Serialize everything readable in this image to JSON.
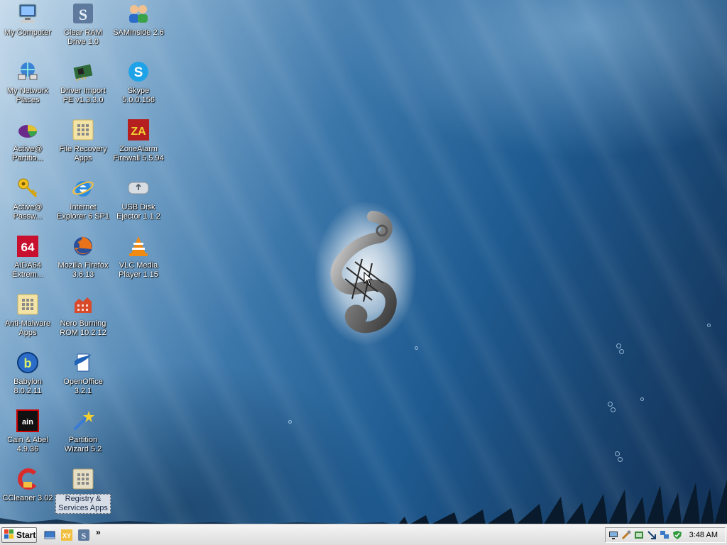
{
  "desktop": {
    "icons": [
      {
        "id": "my-computer",
        "label": "My Computer",
        "icon": "computer-icon"
      },
      {
        "id": "my-network-places",
        "label": "My Network\nPlaces",
        "icon": "network-icon"
      },
      {
        "id": "active-partition",
        "label": "Active@\nPartitio...",
        "icon": "partition-pie-icon"
      },
      {
        "id": "active-password",
        "label": "Active@\nPassw...",
        "icon": "key-icon"
      },
      {
        "id": "aida64",
        "label": "AIDA64\nExtrem...",
        "icon": "aida64-icon"
      },
      {
        "id": "anti-malware",
        "label": "Anti-Malware\nApps",
        "icon": "folder-apps-icon"
      },
      {
        "id": "babylon",
        "label": "Babylon\n8.0.2.11",
        "icon": "babylon-icon"
      },
      {
        "id": "cain-abel",
        "label": "Cain & Abel\n4.9.36",
        "icon": "cain-icon"
      },
      {
        "id": "ccleaner",
        "label": "CCleaner 3.02",
        "icon": "ccleaner-icon"
      },
      {
        "id": "clear-ram",
        "label": "Clear RAM\nDrive 1.0",
        "icon": "ram-drive-icon"
      },
      {
        "id": "driver-import",
        "label": "Driver Import\nPE v1.3.3.0",
        "icon": "chip-icon"
      },
      {
        "id": "file-recovery",
        "label": "File Recovery\nApps",
        "icon": "folder-apps-icon"
      },
      {
        "id": "internet-explorer",
        "label": "Internet\nExplorer 6 SP1",
        "icon": "ie-icon"
      },
      {
        "id": "mozilla-firefox",
        "label": "Mozilla Firefox\n3.6.13",
        "icon": "firefox-icon"
      },
      {
        "id": "nero",
        "label": "Nero Burning\nROM 10.2.12",
        "icon": "nero-icon"
      },
      {
        "id": "openoffice",
        "label": "OpenOffice\n3.2.1",
        "icon": "openoffice-icon"
      },
      {
        "id": "partition-wizard",
        "label": "Partition\nWizard 5.2",
        "icon": "wand-icon"
      },
      {
        "id": "registry-services",
        "label": "Registry &\nServices Apps",
        "icon": "folder-apps-icon",
        "selected": true
      },
      {
        "id": "saminside",
        "label": "SAMInside 2.6",
        "icon": "users-icon"
      },
      {
        "id": "skype",
        "label": "Skype\n5.0.0.156",
        "icon": "skype-icon"
      },
      {
        "id": "zonealarm",
        "label": "ZoneAlarm\nFirewall 5.5.94",
        "icon": "zonealarm-icon"
      },
      {
        "id": "usb-ejector",
        "label": "USB Disk\nEjector 1.1.2",
        "icon": "usb-drive-icon"
      },
      {
        "id": "vlc",
        "label": "VLC Media\nPlayer 1.15",
        "icon": "vlc-cone-icon"
      }
    ],
    "wallpaper_logo": "s-serpent-logo"
  },
  "taskbar": {
    "start_label": "Start",
    "quick_launch": [
      "show-desktop-icon",
      "xy-explorer-icon",
      "ram-drive-icon"
    ],
    "overflow": "»",
    "tray_icons": [
      "monitor-icon",
      "tools-icon",
      "device-icon",
      "arrow-icon",
      "network-icon",
      "shield-icon"
    ],
    "clock": "3:48 AM"
  },
  "colors": {
    "accent": "#1f5b91",
    "taskbar": "#e6e6e6"
  }
}
